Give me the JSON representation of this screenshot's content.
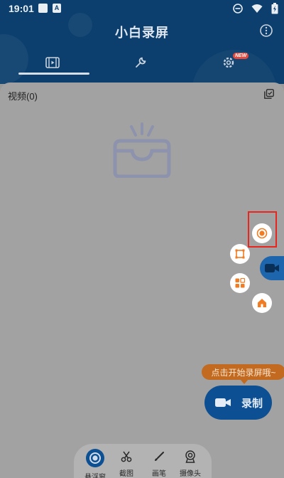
{
  "status_bar": {
    "time": "19:01",
    "a_icon_letter": "A"
  },
  "app": {
    "title": "小白录屏"
  },
  "tabs": [
    {
      "name": "video-tab",
      "icon": "video-list-icon"
    },
    {
      "name": "tools-tab",
      "icon": "wrench-icon"
    },
    {
      "name": "settings-tab",
      "icon": "gear-icon",
      "badge": "NEW"
    }
  ],
  "content": {
    "video_label": "视频(0)",
    "empty_icon": "empty-inbox-icon"
  },
  "floating_menu": {
    "items": [
      "record-dot-icon",
      "crop-frame-icon",
      "apps-grid-icon",
      "home-icon"
    ],
    "camera_icon": "video-camera-icon"
  },
  "tooltip": "点击开始录屏哦~",
  "record_button": {
    "label": "录制"
  },
  "bottom_tools": [
    {
      "label": "悬浮窗",
      "icon": "floating-window-icon"
    },
    {
      "label": "截图",
      "icon": "scissors-icon"
    },
    {
      "label": "画笔",
      "icon": "brush-icon"
    },
    {
      "label": "摄像头",
      "icon": "webcam-icon"
    }
  ],
  "colors": {
    "header_blue": "#0c3f6d",
    "accent_orange": "#f07c23",
    "highlight_red": "#e8261f",
    "record_blue": "#0c4f92"
  }
}
